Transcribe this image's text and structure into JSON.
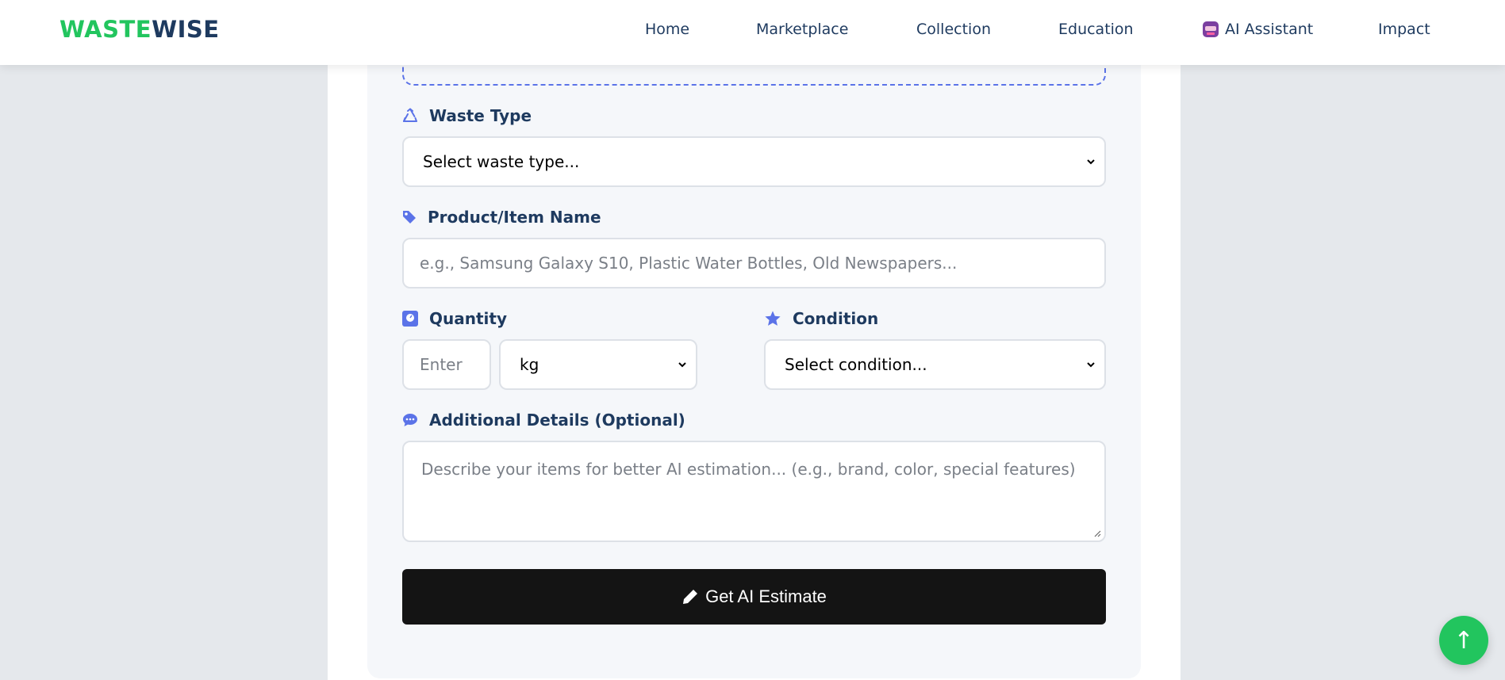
{
  "brand": {
    "part1": "WASTE",
    "part2": "WISE"
  },
  "nav": {
    "home": "Home",
    "marketplace": "Marketplace",
    "collection": "Collection",
    "education": "Education",
    "ai_assistant": "AI Assistant",
    "impact": "Impact"
  },
  "form": {
    "waste_type": {
      "label": "Waste Type",
      "selected": "Select waste type..."
    },
    "product_name": {
      "label": "Product/Item Name",
      "placeholder": "e.g., Samsung Galaxy S10, Plastic Water Bottles, Old Newspapers..."
    },
    "quantity": {
      "label": "Quantity",
      "placeholder": "Enter",
      "unit_selected": "kg"
    },
    "condition": {
      "label": "Condition",
      "selected": "Select condition..."
    },
    "details": {
      "label": "Additional Details (Optional)",
      "placeholder": "Describe your items for better AI estimation... (e.g., brand, color, special features)"
    },
    "submit_label": "Get AI Estimate"
  },
  "scroll_top_symbol": "↑",
  "colors": {
    "brand_green": "#22c55e",
    "brand_navy": "#1e3a5f",
    "icon_blue": "#5b73e8",
    "button_dark": "#141414"
  },
  "icons": {
    "waste_type": "recycle-icon",
    "product_name": "tag-icon",
    "quantity": "weight-scale-icon",
    "condition": "star-icon",
    "details": "comment-dots-icon",
    "submit": "pencil-icon",
    "ai_assistant": "robot-icon"
  }
}
